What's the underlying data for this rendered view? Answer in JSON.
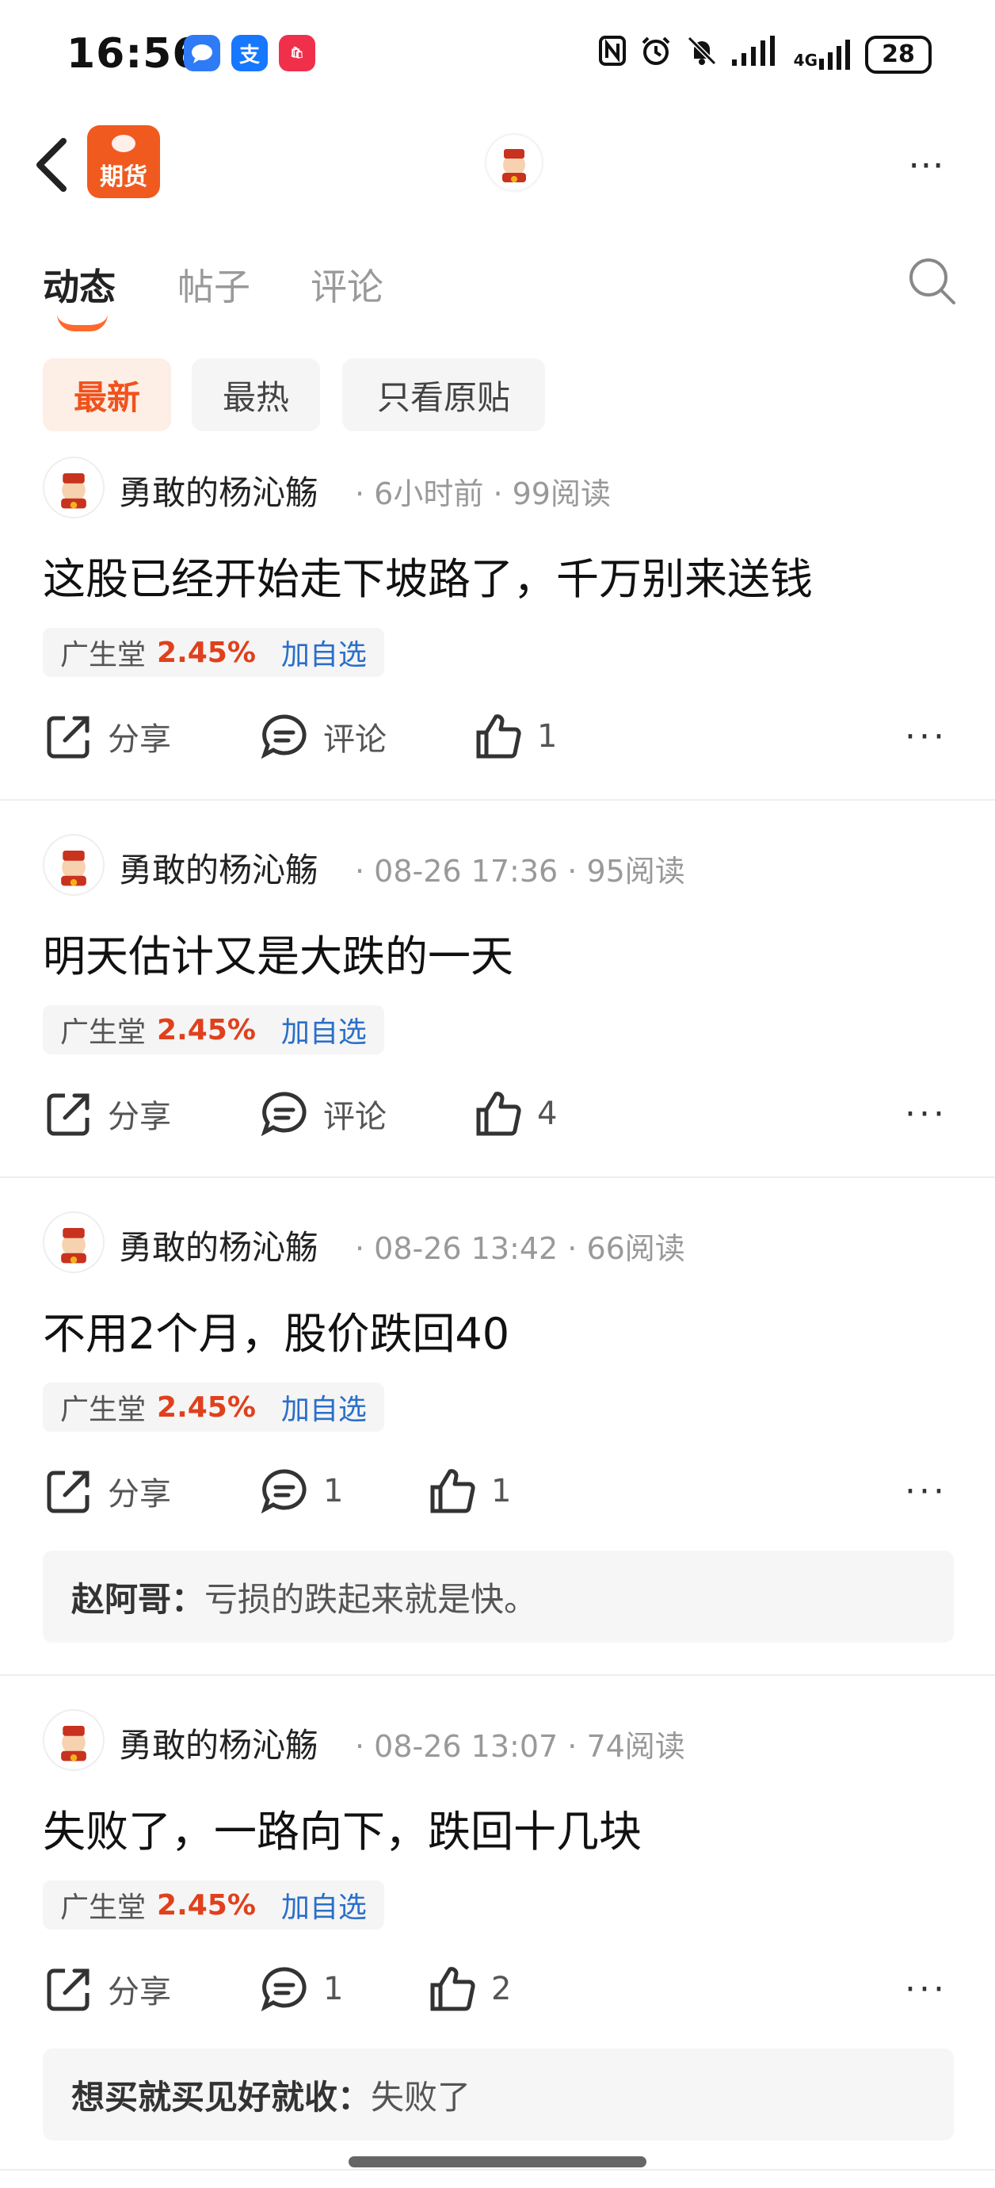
{
  "status_bar": {
    "time": "16:56",
    "battery": "28",
    "network": "4G",
    "apps": [
      {
        "icon": "message-icon",
        "color": "#2f7bf6"
      },
      {
        "icon": "alipay-icon",
        "color": "#1677ff",
        "label": "支"
      },
      {
        "icon": "appgallery-icon",
        "color": "#f0304a",
        "label": "AppGallery"
      }
    ]
  },
  "nav": {
    "app_label": "期货",
    "more": "⋯"
  },
  "tabs": [
    {
      "label": "动态",
      "active": true
    },
    {
      "label": "帖子",
      "active": false
    },
    {
      "label": "评论",
      "active": false
    }
  ],
  "filters": [
    {
      "label": "最新",
      "active": true
    },
    {
      "label": "最热",
      "active": false
    },
    {
      "label": "只看原贴",
      "active": false
    }
  ],
  "posts": [
    {
      "author": "勇敢的杨沁觞",
      "time": "6小时前",
      "reads": "99阅读",
      "content": "这股已经开始走下坡路了，千万别来送钱",
      "stock": {
        "name": "广生堂",
        "change": "2.45%",
        "add": "加自选"
      },
      "actions": {
        "share": "分享",
        "comment": "评论",
        "likes": "1"
      }
    },
    {
      "author": "勇敢的杨沁觞",
      "time": "08-26 17:36",
      "reads": "95阅读",
      "content": "明天估计又是大跌的一天",
      "stock": {
        "name": "广生堂",
        "change": "2.45%",
        "add": "加自选"
      },
      "actions": {
        "share": "分享",
        "comment": "评论",
        "likes": "4"
      }
    },
    {
      "author": "勇敢的杨沁觞",
      "time": "08-26 13:42",
      "reads": "66阅读",
      "content": "不用2个月，股价跌回40",
      "stock": {
        "name": "广生堂",
        "change": "2.45%",
        "add": "加自选"
      },
      "actions": {
        "share": "分享",
        "comment": "1",
        "likes": "1"
      },
      "reply": {
        "name": "赵阿哥：",
        "text": "亏损的跌起来就是快。"
      }
    },
    {
      "author": "勇敢的杨沁觞",
      "time": "08-26 13:07",
      "reads": "74阅读",
      "content": "失败了，一路向下，跌回十几块",
      "stock": {
        "name": "广生堂",
        "change": "2.45%",
        "add": "加自选"
      },
      "actions": {
        "share": "分享",
        "comment": "1",
        "likes": "2"
      },
      "reply": {
        "name": "想买就买见好就收：",
        "text": "失败了"
      }
    }
  ]
}
